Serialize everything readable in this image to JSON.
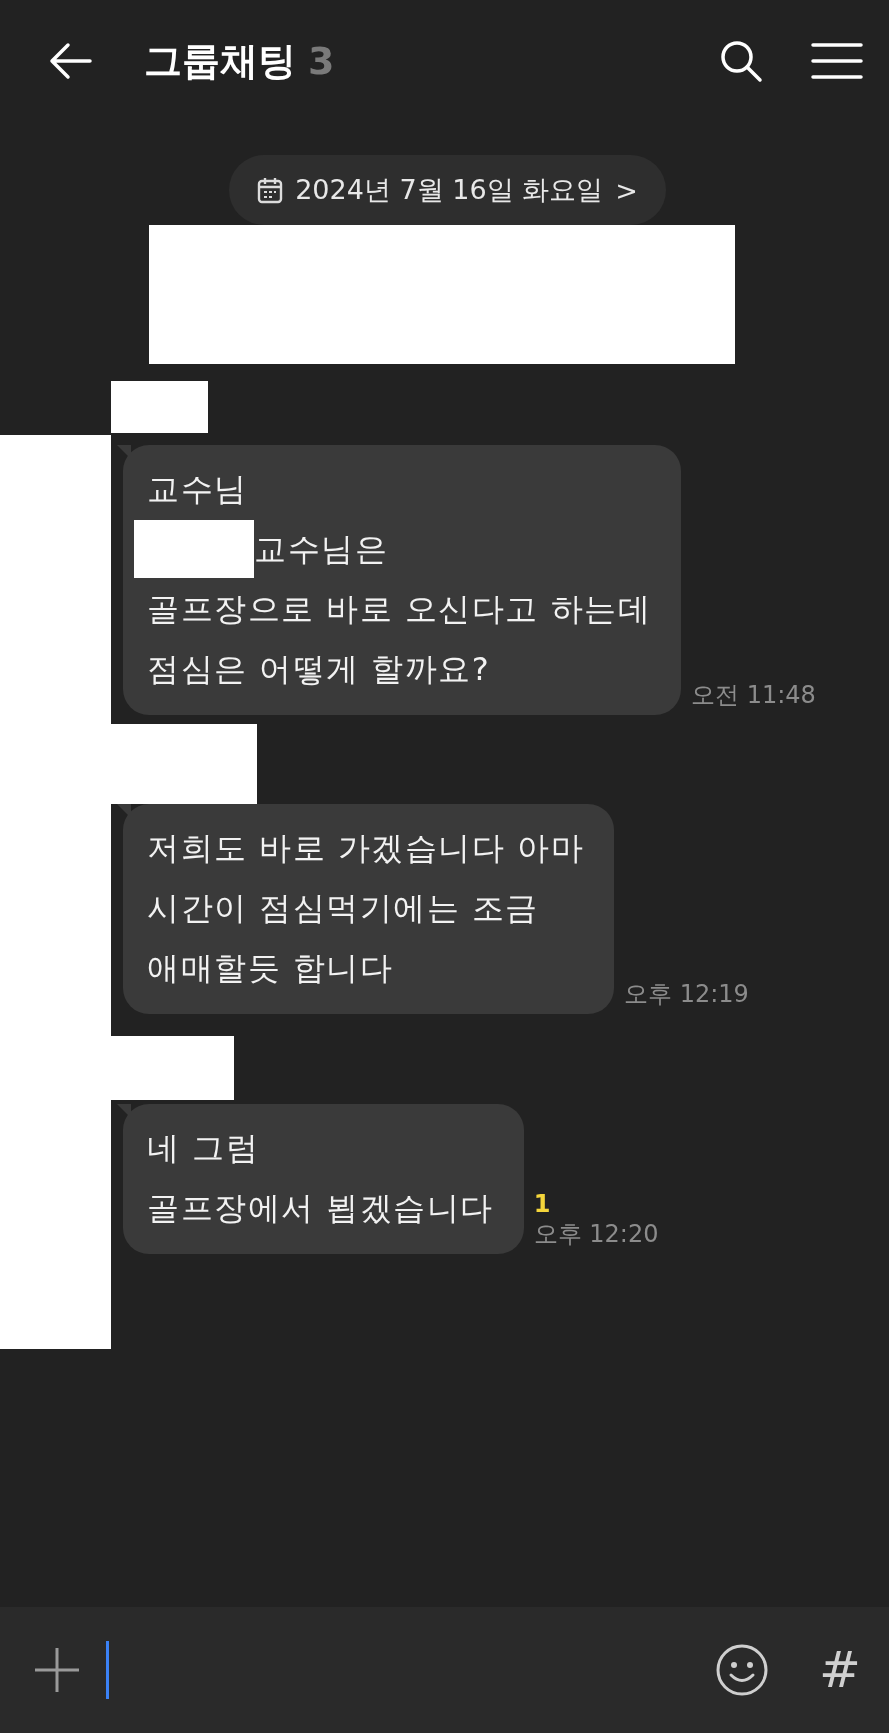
{
  "header": {
    "title": "그룹채팅",
    "member_count": "3"
  },
  "date_chip": {
    "label": "2024년 7월 16일 화요일",
    "arrow": ">"
  },
  "messages": [
    {
      "lines": [
        {
          "text": "교수님",
          "redacted_before": false
        },
        {
          "text": "교수님은",
          "redacted_before": true
        },
        {
          "text": "골프장으로 바로 오신다고 하는데",
          "redacted_before": false
        },
        {
          "text": "점심은 어떻게 할까요?",
          "redacted_before": false
        }
      ],
      "time": "오전 11:48"
    },
    {
      "lines": [
        {
          "text": "저희도 바로 가겠습니다 아마",
          "redacted_before": false
        },
        {
          "text": "시간이 점심먹기에는 조금",
          "redacted_before": false
        },
        {
          "text": "애매할듯 합니다",
          "redacted_before": false
        }
      ],
      "time": "오후 12:19"
    },
    {
      "lines": [
        {
          "text": "네 그럼",
          "redacted_before": false
        },
        {
          "text": "골프장에서 뵙겠습니다",
          "redacted_before": false
        }
      ],
      "time": "오후 12:20",
      "unread": "1"
    }
  ],
  "composer": {
    "hash": "#"
  }
}
